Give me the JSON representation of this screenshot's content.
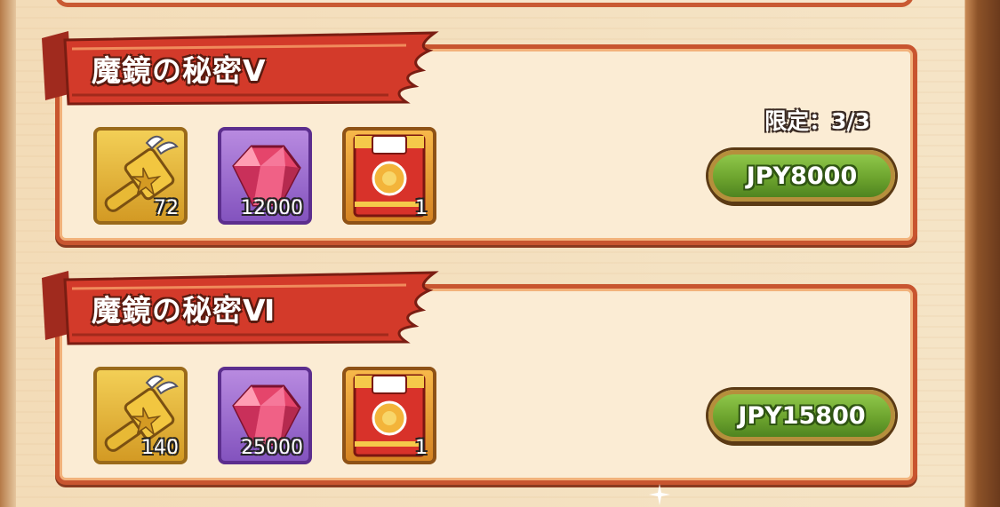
{
  "packs": [
    {
      "title": "魔鏡の秘密Ⅴ",
      "limit": "限定：3/3",
      "price": "JPY8000",
      "items": [
        {
          "icon": "winged-hammer-icon",
          "qty": "72"
        },
        {
          "icon": "pink-gem-icon",
          "qty": "12000"
        },
        {
          "icon": "red-ticket-icon",
          "qty": "1"
        }
      ]
    },
    {
      "title": "魔鏡の秘密Ⅵ",
      "price": "JPY15800",
      "items": [
        {
          "icon": "winged-hammer-icon",
          "qty": "140"
        },
        {
          "icon": "pink-gem-icon",
          "qty": "25000"
        },
        {
          "icon": "red-ticket-icon",
          "qty": "1"
        }
      ]
    }
  ],
  "colors": {
    "card_border": "#c8552f",
    "card_bg": "#fbecd4",
    "banner_red": "#d33a2a",
    "button_green": "#6da42e"
  }
}
